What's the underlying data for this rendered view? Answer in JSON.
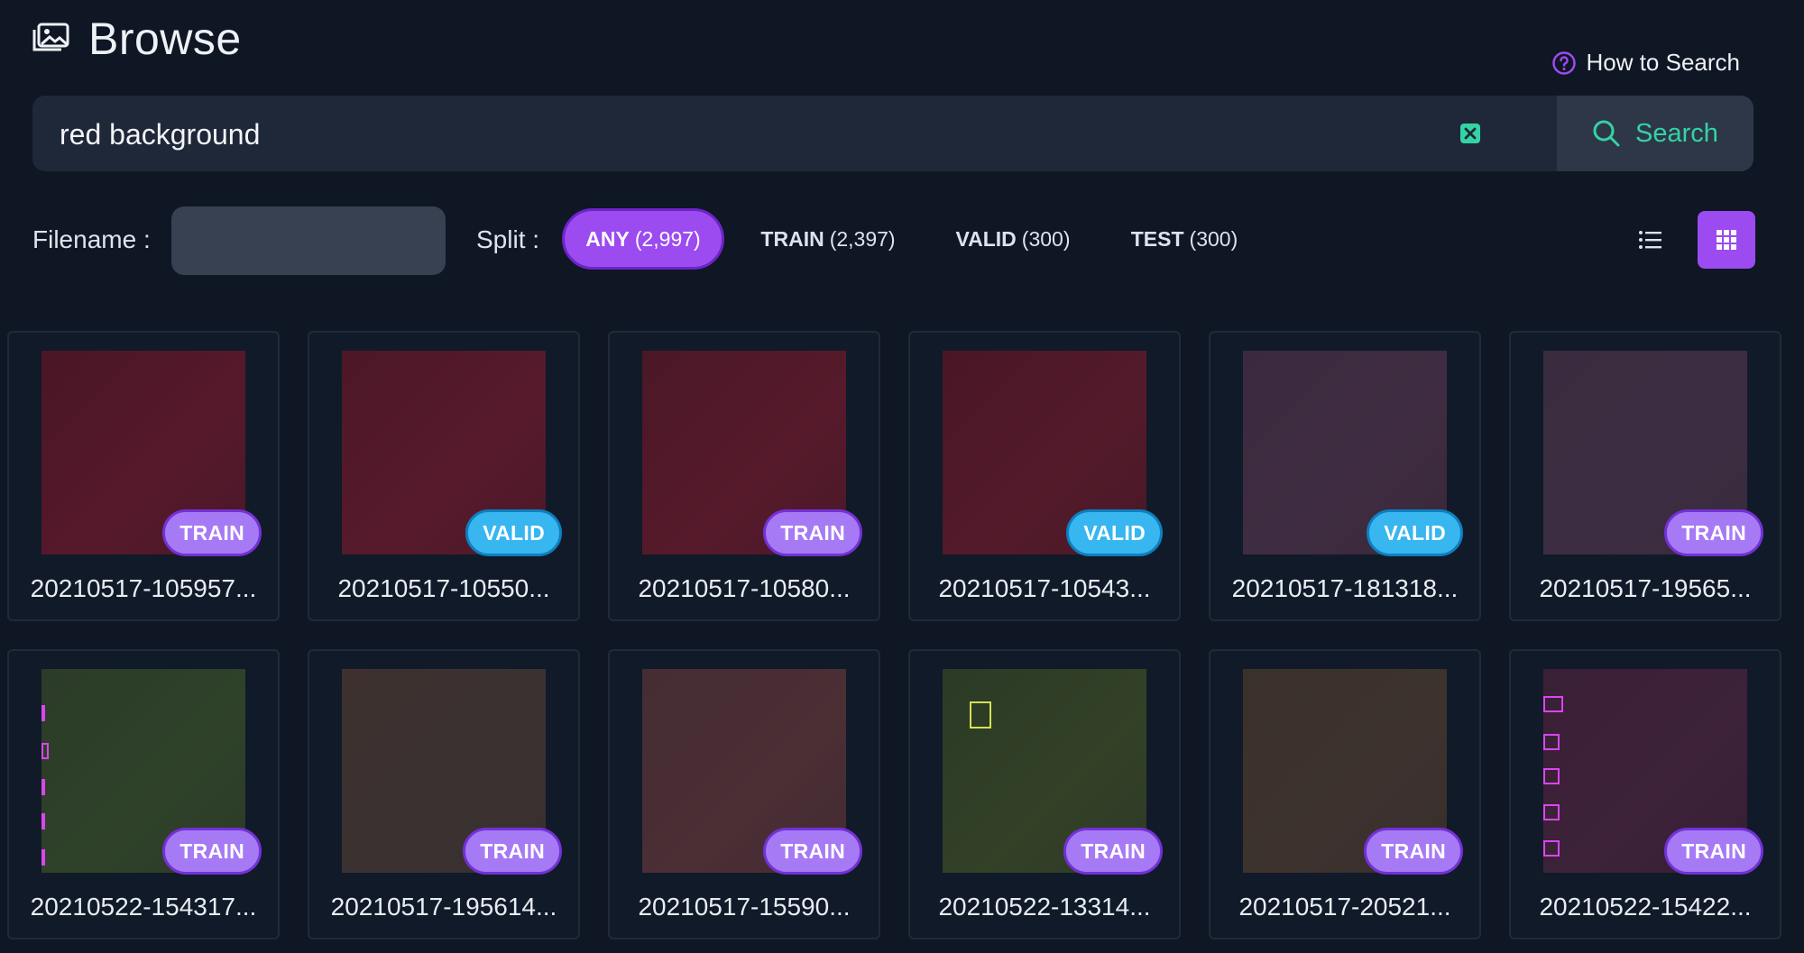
{
  "page": {
    "title": "Browse",
    "icon": "images-icon"
  },
  "help": {
    "label": "How to Search",
    "icon": "question-circle-icon"
  },
  "search": {
    "value": "red background",
    "placeholder": "",
    "clear_icon": "clear-x-icon",
    "button_label": "Search",
    "button_icon": "magnifier-icon"
  },
  "filters": {
    "filename_label": "Filename :",
    "filename_value": "",
    "split_label": "Split :",
    "splits": [
      {
        "name": "ANY",
        "count": "(2,997)",
        "active": true
      },
      {
        "name": "TRAIN",
        "count": "(2,397)",
        "active": false
      },
      {
        "name": "VALID",
        "count": "(300)",
        "active": false
      },
      {
        "name": "TEST",
        "count": "(300)",
        "active": false
      }
    ],
    "view_modes": [
      "list-view-icon",
      "grid-view-icon"
    ],
    "active_view": "grid"
  },
  "colors": {
    "accent": "#9b4bf0",
    "search_text": "#34d3a5",
    "train_badge": "#a77af5",
    "valid_badge": "#38b6f0"
  },
  "images": [
    {
      "filename": "20210517-105957...",
      "split": "TRAIN"
    },
    {
      "filename": "20210517-10550...",
      "split": "VALID"
    },
    {
      "filename": "20210517-10580...",
      "split": "TRAIN"
    },
    {
      "filename": "20210517-10543...",
      "split": "VALID"
    },
    {
      "filename": "20210517-181318...",
      "split": "VALID"
    },
    {
      "filename": "20210517-19565...",
      "split": "TRAIN"
    },
    {
      "filename": "20210522-154317...",
      "split": "TRAIN"
    },
    {
      "filename": "20210517-195614...",
      "split": "TRAIN"
    },
    {
      "filename": "20210517-15590...",
      "split": "TRAIN"
    },
    {
      "filename": "20210522-13314...",
      "split": "TRAIN"
    },
    {
      "filename": "20210517-20521...",
      "split": "TRAIN"
    },
    {
      "filename": "20210522-15422...",
      "split": "TRAIN"
    }
  ]
}
